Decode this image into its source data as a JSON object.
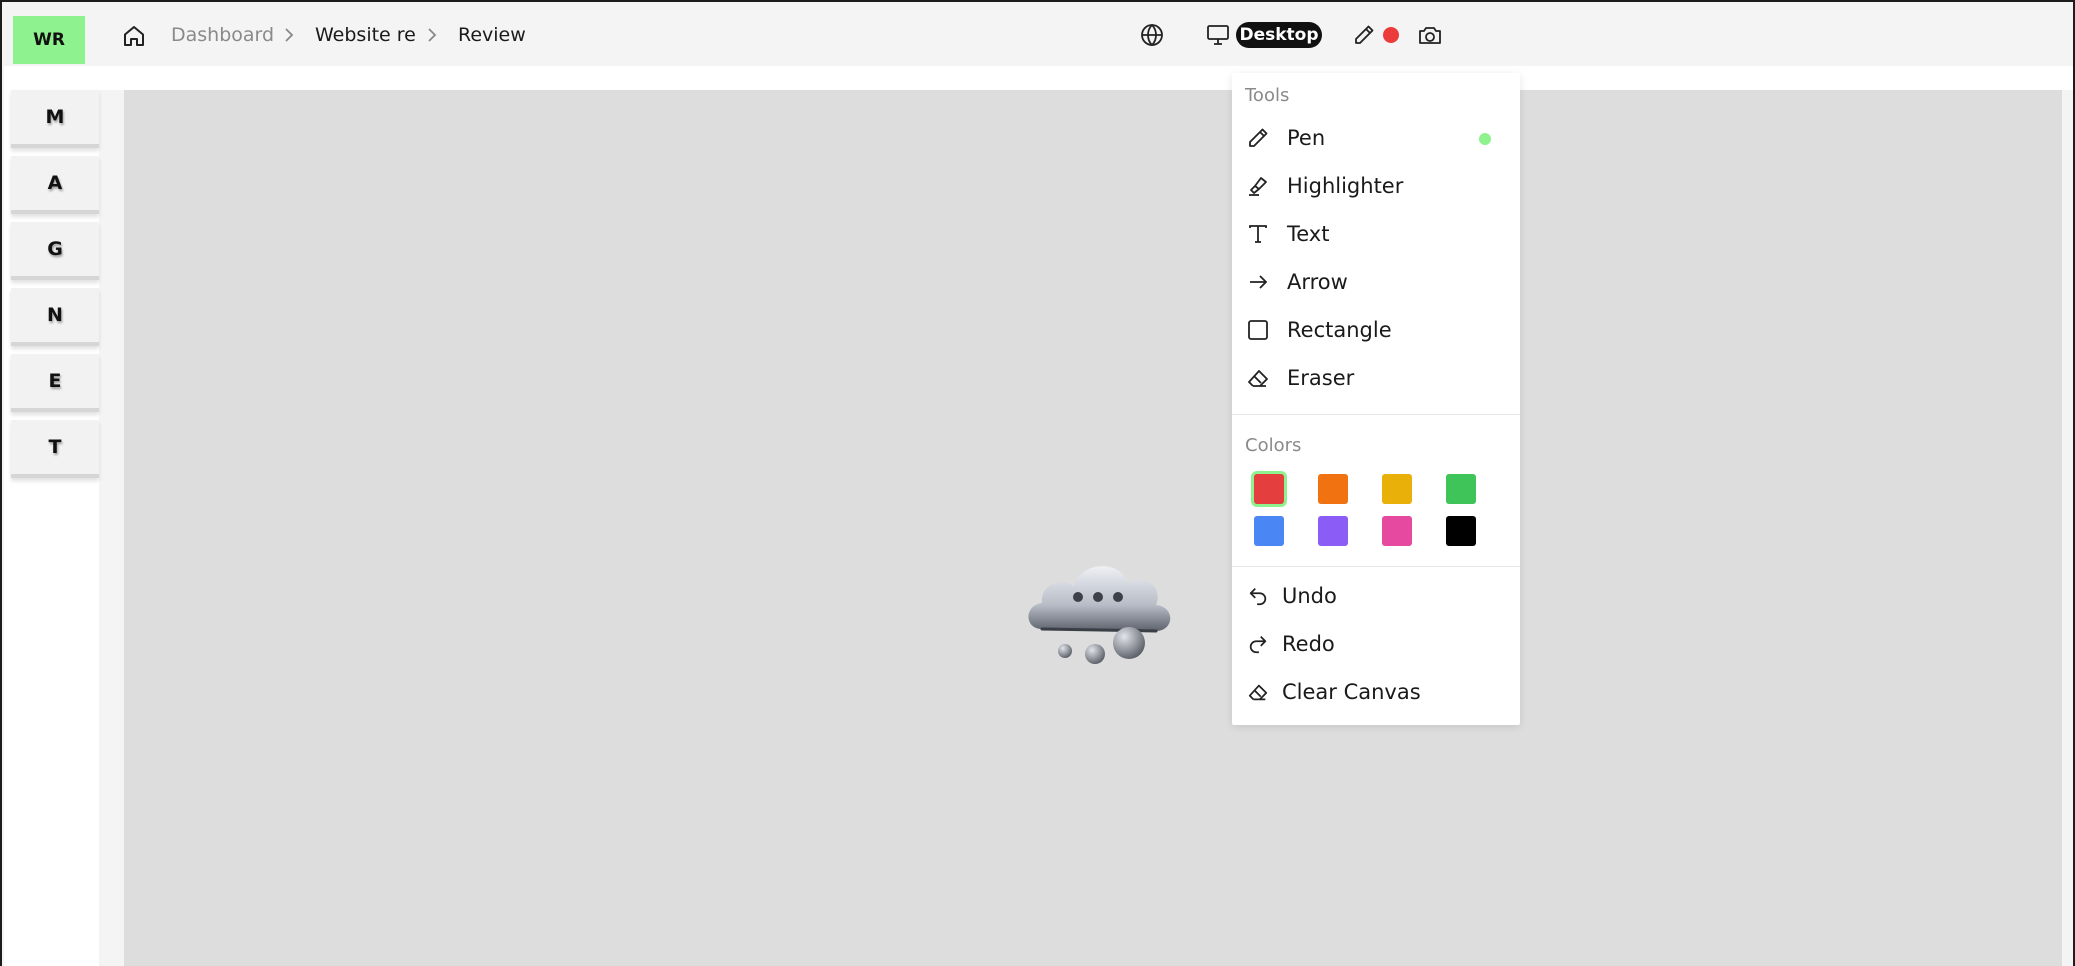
{
  "app": {
    "logo_text": "WR"
  },
  "breadcrumb": {
    "items": [
      "Dashboard",
      "Website re",
      "Review"
    ]
  },
  "toolbar": {
    "device_label": "Desktop",
    "record_color": "#ec3b3b"
  },
  "sidebar": {
    "items": [
      {
        "label": "M"
      },
      {
        "label": "A"
      },
      {
        "label": "G"
      },
      {
        "label": "N"
      },
      {
        "label": "E"
      },
      {
        "label": "T"
      }
    ]
  },
  "tools_panel": {
    "tools_heading": "Tools",
    "tools": [
      {
        "label": "Pen",
        "icon": "pen-icon",
        "active": true
      },
      {
        "label": "Highlighter",
        "icon": "highlighter-icon",
        "active": false
      },
      {
        "label": "Text",
        "icon": "text-icon",
        "active": false
      },
      {
        "label": "Arrow",
        "icon": "arrow-right-icon",
        "active": false
      },
      {
        "label": "Rectangle",
        "icon": "square-icon",
        "active": false
      },
      {
        "label": "Eraser",
        "icon": "eraser-icon",
        "active": false
      }
    ],
    "colors_heading": "Colors",
    "colors": [
      {
        "hex": "#e53e3e",
        "selected": true
      },
      {
        "hex": "#f07210",
        "selected": false
      },
      {
        "hex": "#eab00a",
        "selected": false
      },
      {
        "hex": "#3fc45a",
        "selected": false
      },
      {
        "hex": "#4a87f5",
        "selected": false
      },
      {
        "hex": "#8b5cf6",
        "selected": false
      },
      {
        "hex": "#e64aa0",
        "selected": false
      },
      {
        "hex": "#000000",
        "selected": false
      }
    ],
    "actions": [
      {
        "label": "Undo",
        "icon": "undo-icon"
      },
      {
        "label": "Redo",
        "icon": "redo-icon"
      },
      {
        "label": "Clear Canvas",
        "icon": "eraser-icon"
      }
    ]
  },
  "canvas": {
    "loading_icon": "thinking-cloud-icon"
  }
}
